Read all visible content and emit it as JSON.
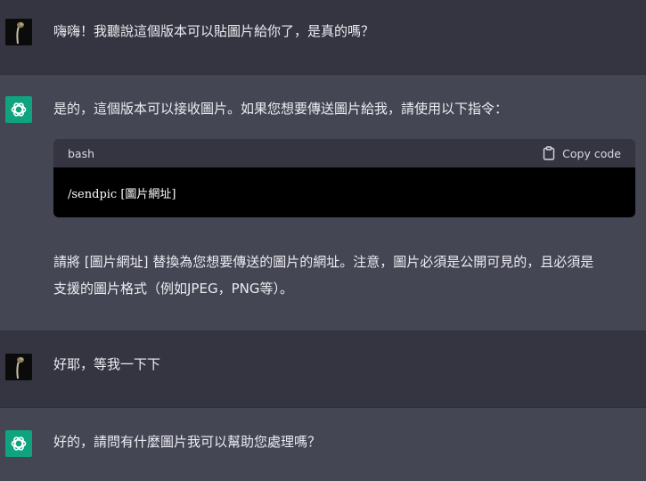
{
  "conversation": [
    {
      "role": "user",
      "text": "嗨嗨！我聽說這個版本可以貼圖片給你了，是真的嗎？"
    },
    {
      "role": "assistant",
      "intro": "是的，這個版本可以接收圖片。如果您想要傳送圖片給我，請使用以下指令：",
      "code": {
        "language": "bash",
        "copy_label": "Copy code",
        "content": "/sendpic [圖片網址]"
      },
      "outro_line1": "請將 [圖片網址] 替換為您想要傳送的圖片的網址。注意，圖片必須是公開可見的，且必須是",
      "outro_line2": "支援的圖片格式（例如JPEG，PNG等）。"
    },
    {
      "role": "user",
      "text": "好耶，等我一下下"
    },
    {
      "role": "assistant",
      "text": "好的，請問有什麼圖片我可以幫助您處理嗎？"
    }
  ],
  "icons": {
    "user_avatar": "user-photo-avatar",
    "assistant_avatar": "openai-logo-icon",
    "copy": "clipboard-icon"
  },
  "colors": {
    "user_bg": "#343541",
    "assistant_bg": "#444654",
    "logo_bg": "#10a37f",
    "code_bg": "#000000"
  }
}
